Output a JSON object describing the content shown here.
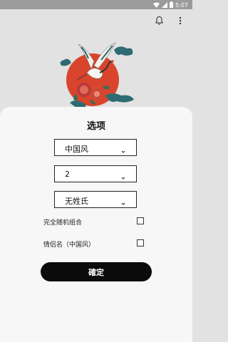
{
  "status_bar": {
    "time": "5:07"
  },
  "icons": {
    "wifi": "wifi-icon",
    "signal": "signal-icon",
    "battery": "battery-icon",
    "bell": "bell-icon",
    "more": "more-vertical-icon",
    "hero": "crane-sun-illustration"
  },
  "sheet": {
    "title": "选项",
    "dropdowns": [
      {
        "value": "中国风"
      },
      {
        "value": "2"
      },
      {
        "value": "无姓氏"
      }
    ],
    "options": [
      {
        "label": "完全随机组合",
        "checked": false
      },
      {
        "label": "情侣名（中国风）",
        "checked": false
      }
    ],
    "confirm_label": "確定"
  },
  "colors": {
    "accent_red": "#d9452c",
    "button_bg": "#0b0b0b",
    "teal": "#2f6b73"
  }
}
